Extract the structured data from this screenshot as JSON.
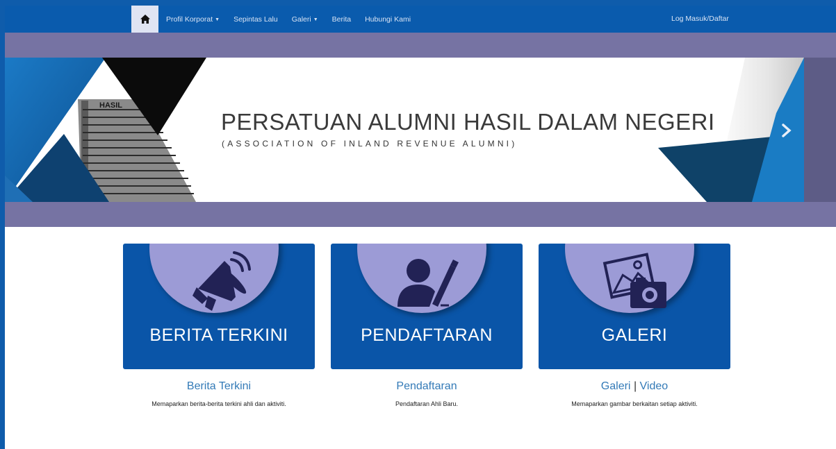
{
  "navbar": {
    "home_icon": "home-icon",
    "items": [
      {
        "label": "Profil Korporat",
        "has_dropdown": true
      },
      {
        "label": "Sepintas Lalu",
        "has_dropdown": false
      },
      {
        "label": "Galeri",
        "has_dropdown": true
      },
      {
        "label": "Berita",
        "has_dropdown": false
      },
      {
        "label": "Hubungi Kami",
        "has_dropdown": false
      }
    ],
    "login_label": "Log Masuk/Daftar"
  },
  "banner": {
    "building_sign": "HASIL",
    "title": "PERSATUAN ALUMNI HASIL DALAM NEGERI",
    "subtitle": "(ASSOCIATION OF INLAND REVENUE ALUMNI)",
    "next_icon": "chevron-right-icon"
  },
  "cards": [
    {
      "label": "BERITA TERKINI",
      "icon": "megaphone-icon",
      "title": "Berita Terkini",
      "description": "Memaparkan berita-berita terkini ahli dan aktiviti."
    },
    {
      "label": "PENDAFTARAN",
      "icon": "user-pen-icon",
      "title": "Pendaftaran",
      "description": "Pendaftaran Ahli Baru."
    },
    {
      "label": "GALERI",
      "icon": "photo-camera-icon",
      "title_parts": [
        "Galeri",
        "|",
        "Video"
      ],
      "description": "Memaparkan gambar berkaitan setiap aktiviti."
    }
  ],
  "colors": {
    "navbar": "#0a5bad",
    "band": "#7673a3",
    "card": "#0a55a8",
    "card_circle": "#9c9bd6",
    "link": "#337ab7"
  }
}
